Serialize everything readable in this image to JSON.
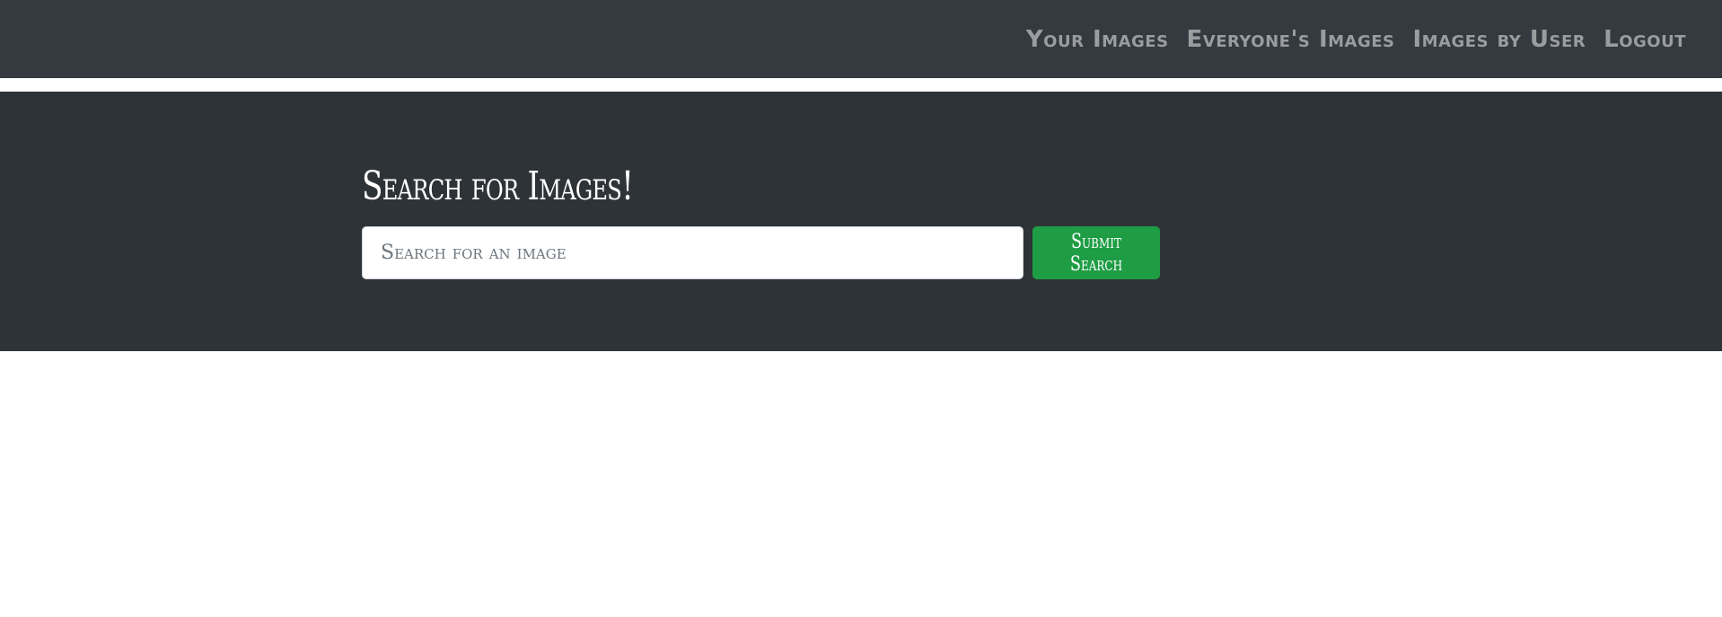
{
  "navbar": {
    "links": [
      {
        "label": "Your Images"
      },
      {
        "label": "Everyone's Images"
      },
      {
        "label": "Images by User"
      },
      {
        "label": "Logout"
      }
    ]
  },
  "search": {
    "title": "Search for Images!",
    "placeholder": "Search for an image",
    "value": "",
    "submit_label": "Submit Search"
  },
  "colors": {
    "navbar_bg": "#343a40",
    "hero_bg": "#2e3338",
    "nav_link": "#9a9da0",
    "submit_bg": "#1f9d45"
  }
}
